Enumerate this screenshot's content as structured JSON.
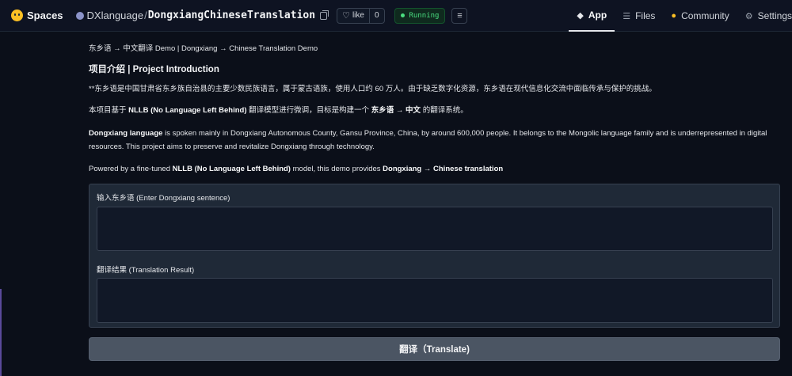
{
  "header": {
    "brand": "Spaces",
    "owner": "DXlanguage",
    "separator": "/",
    "repo": "DongxiangChineseTranslation",
    "like_label": "like",
    "like_count": "0",
    "status": "Running",
    "status_color": "#4ade80",
    "nav": [
      {
        "label": "App",
        "icon": "cube-icon",
        "active": true
      },
      {
        "label": "Files",
        "icon": "files-icon",
        "active": false
      },
      {
        "label": "Community",
        "icon": "community-icon",
        "active": false
      },
      {
        "label": "Settings",
        "icon": "gear-icon",
        "active": false
      }
    ]
  },
  "content": {
    "demo_title": "东乡语 → 中文翻译 Demo | Dongxiang → Chinese Translation Demo",
    "intro_heading": "项目介绍 | Project Introduction",
    "p1": "**东乡语是中国甘肃省东乡族自治县的主要少数民族语言，属于蒙古语族，使用人口约 60 万人。由于缺乏数字化资源，东乡语在现代信息化交流中面临传承与保护的挑战。",
    "p2_a": "本项目基于 ",
    "p2_b": "NLLB (No Language Left Behind)",
    "p2_c": " 翻译模型进行微调，目标是构建一个 ",
    "p2_d": "东乡语 → 中文",
    "p2_e": " 的翻译系统。",
    "p3_a": "Dongxiang language",
    "p3_b": " is spoken mainly in Dongxiang Autonomous County, Gansu Province, China, by around 600,000 people. It belongs to the Mongolic language family and is underrepresented in digital resources. This project aims to preserve and revitalize Dongxiang through technology.",
    "p4_a": "Powered by a fine-tuned ",
    "p4_b": "NLLB (No Language Left Behind)",
    "p4_c": " model, this demo provides ",
    "p4_d": "Dongxiang → Chinese translation"
  },
  "form": {
    "input_label": "输入东乡语 (Enter Dongxiang sentence)",
    "input_value": "",
    "output_label": "翻译结果 (Translation Result)",
    "output_value": "",
    "button_label": "翻译（Translate)"
  }
}
